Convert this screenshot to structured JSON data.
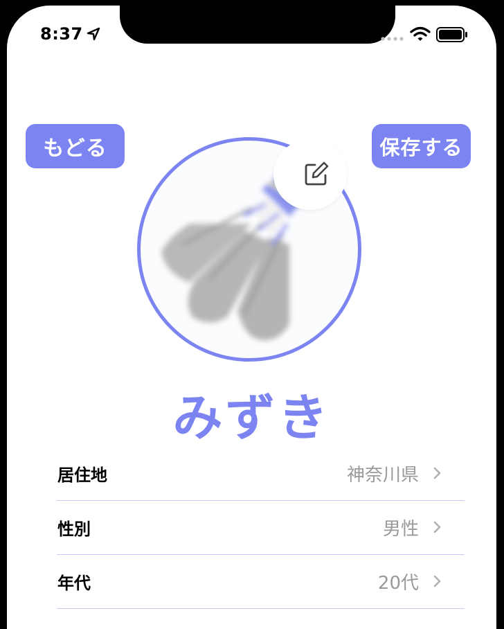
{
  "status_bar": {
    "time": "8:37",
    "icons": [
      "location-arrow-icon",
      "signal-icon",
      "wifi-icon",
      "battery-icon"
    ]
  },
  "nav": {
    "back_label": "もどる",
    "save_label": "保存する"
  },
  "profile": {
    "name": "みずき",
    "avatar_icon": "shuttlecock-image",
    "edit_icon": "edit-icon"
  },
  "fields": [
    {
      "label": "居住地",
      "value": "神奈川県"
    },
    {
      "label": "性別",
      "value": "男性"
    },
    {
      "label": "年代",
      "value": "20代"
    }
  ],
  "colors": {
    "accent": "#7b84f0",
    "divider": "#c8cbf3",
    "value_text": "#9a9a9a"
  }
}
